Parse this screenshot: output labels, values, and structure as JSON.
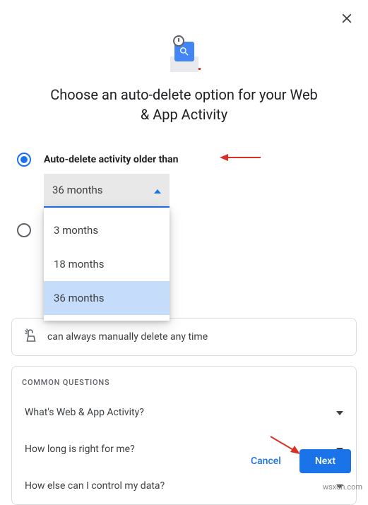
{
  "close_icon": "close",
  "title": "Choose an auto-delete option for your Web & App Activity",
  "option1_label": "Auto-delete activity older than",
  "dropdown_selected": "36 months",
  "dropdown_options": [
    "3 months",
    "18 months",
    "36 months"
  ],
  "info_text": "can always manually delete any time",
  "common_questions": {
    "header": "COMMON QUESTIONS",
    "q1": "What's Web & App Activity?",
    "q2": "How long is right for me?",
    "q3": "How else can I control my data?"
  },
  "buttons": {
    "cancel": "Cancel",
    "next": "Next"
  },
  "watermark": "wsxdn.com"
}
